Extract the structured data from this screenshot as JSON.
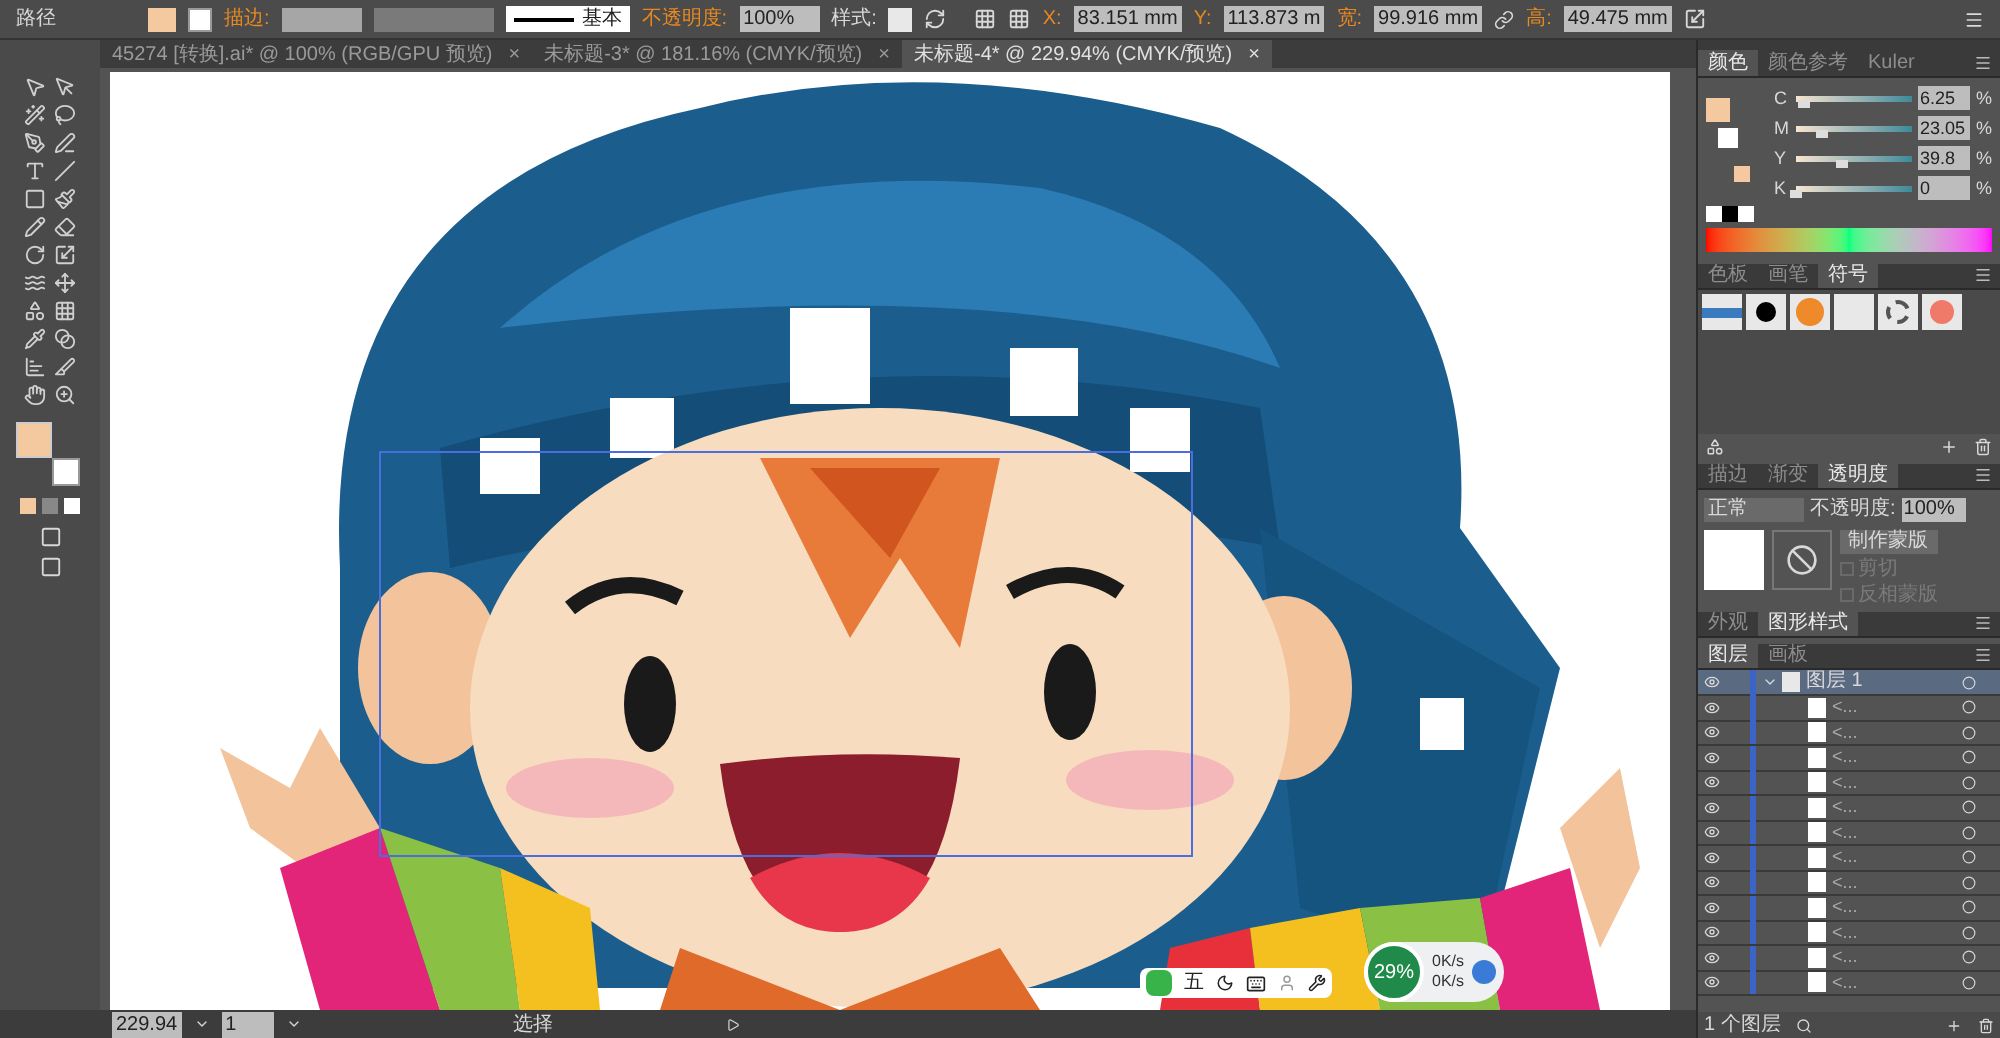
{
  "control_bar": {
    "selection_label": "路径",
    "stroke_label": "描边:",
    "brush": "基本",
    "opacity_label": "不透明度:",
    "opacity": "100%",
    "style_label": "样式:",
    "x_label": "X:",
    "x_value": "83.151 mm",
    "y_label": "Y:",
    "y_value": "113.873 m",
    "w_label": "宽:",
    "w_value": "99.916 mm",
    "h_label": "高:",
    "h_value": "49.475 mm"
  },
  "document_tabs": [
    {
      "title": "45274 [转换].ai* @ 100% (RGB/GPU 预览)",
      "close": "×",
      "selected": false
    },
    {
      "title": "未标题-3* @ 181.16% (CMYK/预览)",
      "close": "×",
      "selected": false
    },
    {
      "title": "未标题-4* @ 229.94% (CMYK/预览)",
      "close": "×",
      "selected": true
    }
  ],
  "color_panel": {
    "tabs": [
      {
        "label": "颜色",
        "selected": true
      },
      {
        "label": "颜色参考",
        "selected": false
      },
      {
        "label": "Kuler",
        "selected": false
      }
    ],
    "channels": [
      {
        "name": "C",
        "value": "6.25",
        "unit": "%",
        "level": 0.0625
      },
      {
        "name": "M",
        "value": "23.05",
        "unit": "%",
        "level": 0.23
      },
      {
        "name": "Y",
        "value": "39.8",
        "unit": "%",
        "level": 0.398
      },
      {
        "name": "K",
        "value": "0",
        "unit": "%",
        "level": 0
      }
    ]
  },
  "symbols_panel": {
    "tabs": [
      {
        "label": "色板",
        "selected": false
      },
      {
        "label": "画笔",
        "selected": false
      },
      {
        "label": "符号",
        "selected": true
      }
    ]
  },
  "transparency_panel": {
    "tabs": [
      {
        "label": "描边",
        "selected": false
      },
      {
        "label": "渐变",
        "selected": false
      },
      {
        "label": "透明度",
        "selected": true
      }
    ],
    "blend_mode": "正常",
    "opacity_label": "不透明度:",
    "opacity": "100%",
    "mask_button": "制作蒙版",
    "options": [
      {
        "label": "剪切",
        "checked": false,
        "disabled": true
      },
      {
        "label": "反相蒙版",
        "checked": false,
        "disabled": true
      }
    ]
  },
  "appearance_panel": {
    "tabs": [
      {
        "label": "外观",
        "selected": false
      },
      {
        "label": "图形样式",
        "selected": true
      }
    ]
  },
  "layers_panel": {
    "tabs": [
      {
        "label": "图层",
        "selected": true
      },
      {
        "label": "画板",
        "selected": false
      }
    ],
    "layer": {
      "name": "图层 1",
      "expanded": true,
      "selected": true,
      "visible": true,
      "children": [
        {
          "name": "<...",
          "visible": true
        },
        {
          "name": "<...",
          "visible": true
        },
        {
          "name": "<...",
          "visible": true
        },
        {
          "name": "<...",
          "visible": true
        },
        {
          "name": "<...",
          "visible": true
        },
        {
          "name": "<...",
          "visible": true
        },
        {
          "name": "<...",
          "visible": true
        },
        {
          "name": "<...",
          "visible": true
        },
        {
          "name": "<...",
          "visible": true
        },
        {
          "name": "<...",
          "visible": true
        },
        {
          "name": "<...",
          "visible": true
        },
        {
          "name": "<...",
          "visible": true
        }
      ]
    },
    "footer": "1 个图层"
  },
  "status_bar": {
    "zoom": "229.94",
    "artboard": "1",
    "tool": "选择"
  },
  "input_method_bar": {
    "mode": "五"
  },
  "network_widget": {
    "load": "29%",
    "upload": "0K/s",
    "download": "0K/s"
  }
}
